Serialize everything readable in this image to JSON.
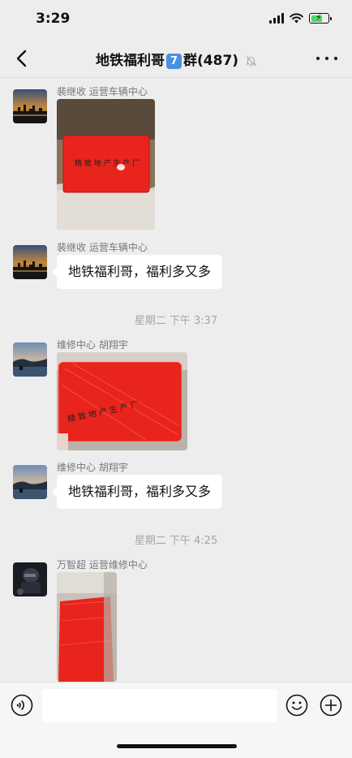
{
  "status_bar": {
    "time": "3:29"
  },
  "nav": {
    "title": "地铁福利哥",
    "badge": "7",
    "title_suffix": "群(487)"
  },
  "messages": [
    {
      "type": "image",
      "sender": "裴继收  运营车辆中心",
      "avatar": "sunset-skyline"
    },
    {
      "type": "text",
      "sender": "裴继收  运营车辆中心",
      "avatar": "sunset-skyline",
      "text": "地铁福利哥，福利多又多"
    },
    {
      "type": "time",
      "text": "星期二 下午 3:37"
    },
    {
      "type": "image",
      "sender": "维修中心  胡翔宇",
      "avatar": "lake-dusk"
    },
    {
      "type": "text",
      "sender": "维修中心  胡翔宇",
      "avatar": "lake-dusk",
      "text": "地铁福利哥，福利多又多"
    },
    {
      "type": "time",
      "text": "星期二 下午 4:25"
    },
    {
      "type": "image",
      "sender": "万智超  运营维修中心",
      "avatar": "dark-motorcycle"
    }
  ],
  "colors": {
    "background": "#ededed",
    "bubble": "#ffffff",
    "gift_box_red": "#e8241c",
    "timestamp": "#a6a6a6",
    "sender": "#777777"
  }
}
